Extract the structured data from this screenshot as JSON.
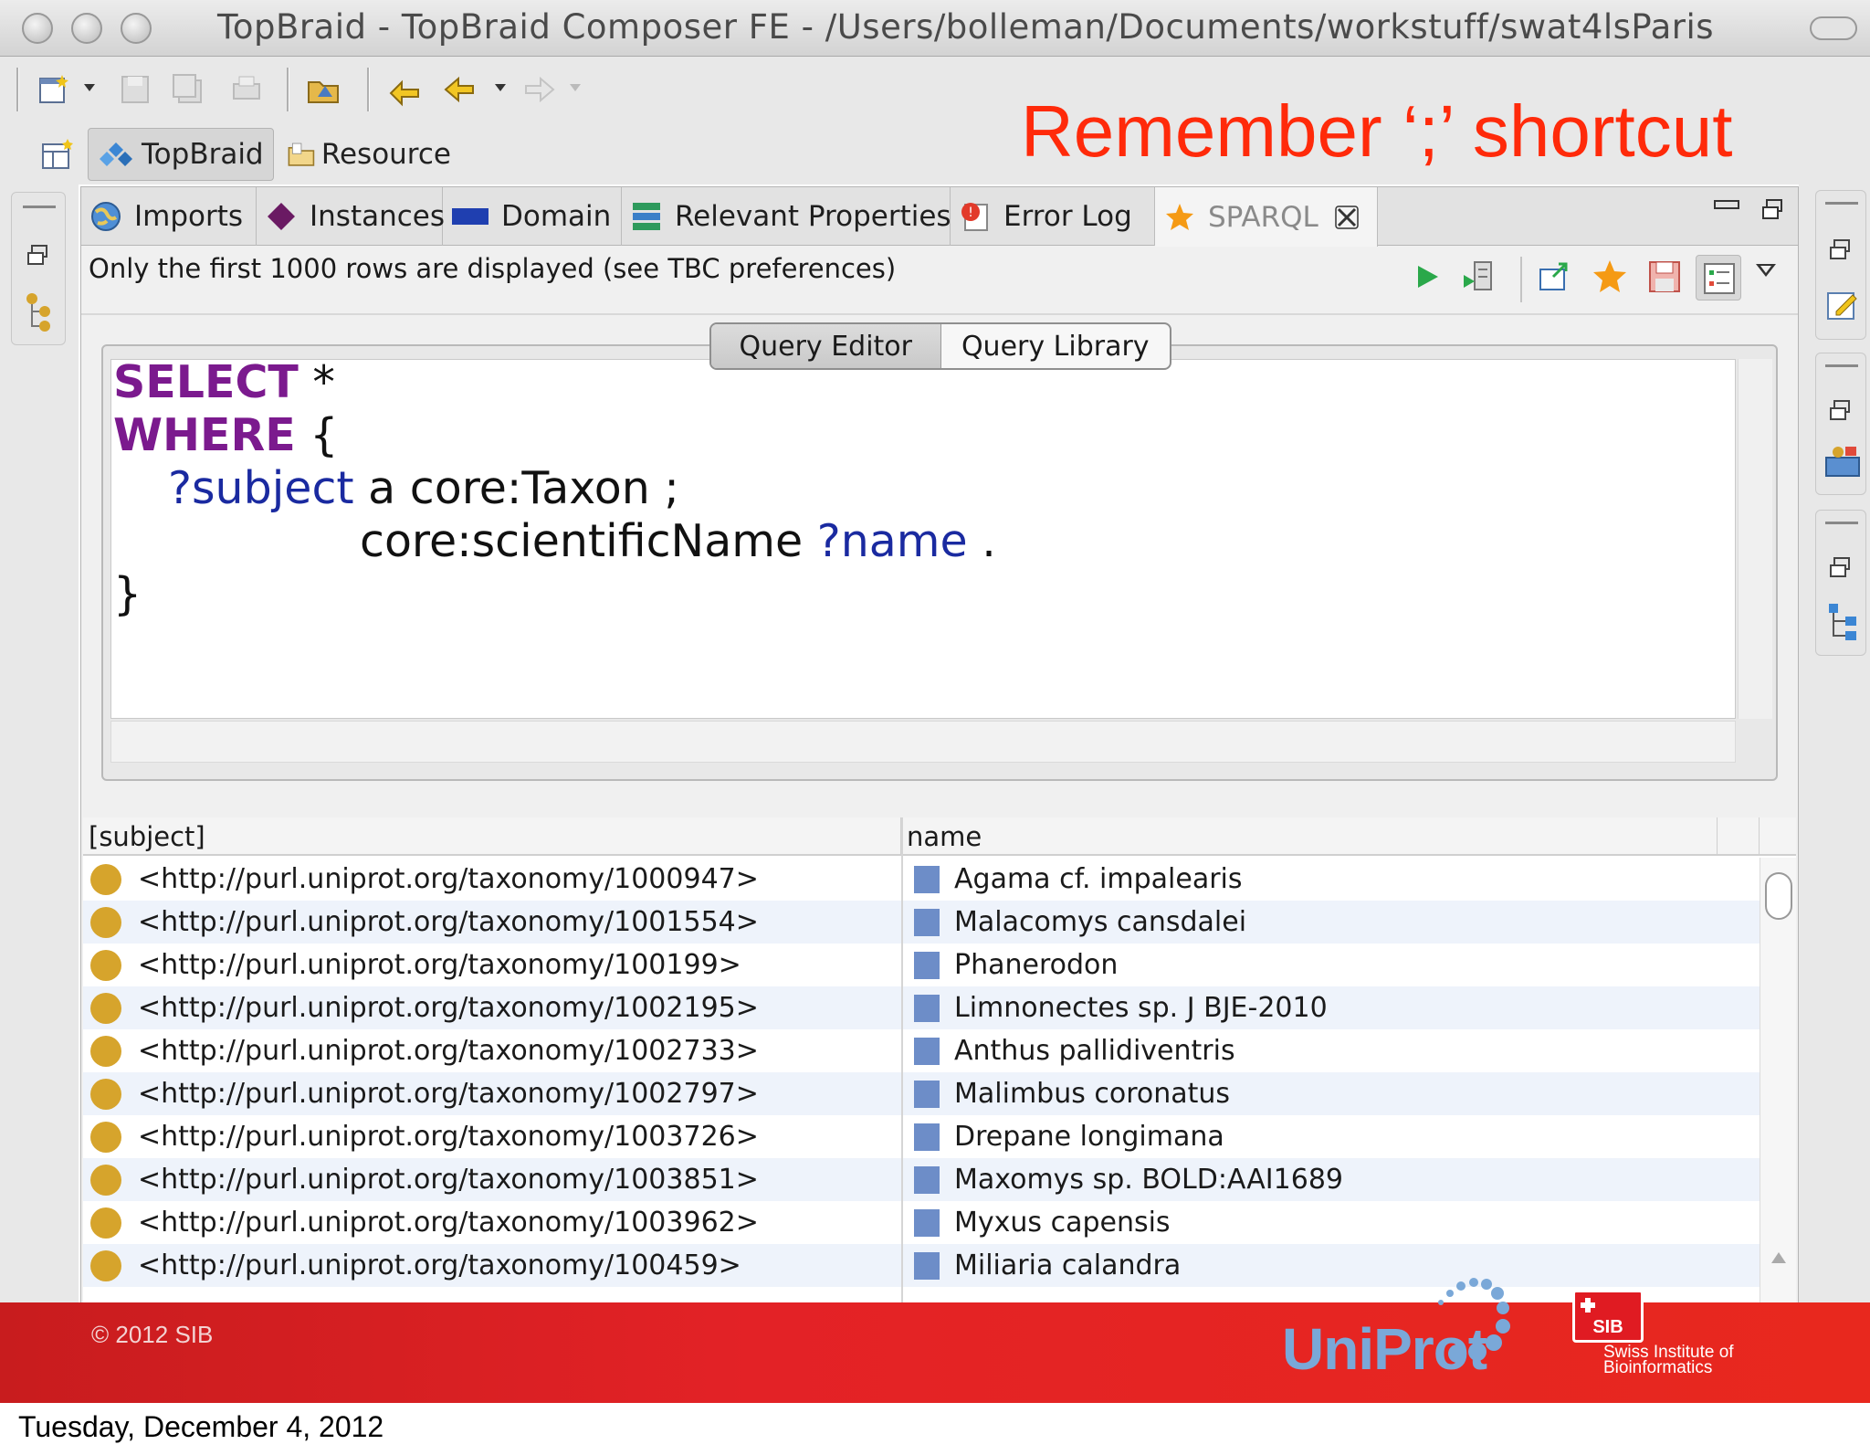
{
  "window": {
    "title": "TopBraid - TopBraid Composer FE - /Users/bolleman/Documents/workstuff/swat4lsParis"
  },
  "perspectives": [
    {
      "label": "TopBraid",
      "active": true
    },
    {
      "label": "Resource",
      "active": false
    }
  ],
  "annotation": "Remember ‘;’ shortcut",
  "tabs": [
    {
      "label": "Imports",
      "icon": "globe-icon"
    },
    {
      "label": "Instances",
      "icon": "diamond-icon"
    },
    {
      "label": "Domain",
      "icon": "blue-bar-icon"
    },
    {
      "label": "Relevant Properties",
      "icon": "properties-icon"
    },
    {
      "label": "Error Log",
      "icon": "error-log-icon"
    },
    {
      "label": "SPARQL",
      "icon": "star-icon",
      "active": true
    }
  ],
  "info_text": "Only the first 1000 rows are displayed (see TBC preferences)",
  "editor_tabs": {
    "query_editor": "Query Editor",
    "query_library": "Query Library"
  },
  "query": {
    "line1_kw": "SELECT",
    "line1_rest": " *",
    "line2_kw": "WHERE",
    "line2_rest": " {",
    "line3_var": "?subject",
    "line3_rest": " a core:Taxon ;",
    "line4_pre": "core:scientificName ",
    "line4_var": "?name",
    "line4_rest": " .",
    "line5": "}"
  },
  "results": {
    "columns": [
      "[subject]",
      "name"
    ],
    "rows": [
      {
        "subject": "<http://purl.uniprot.org/taxonomy/1000947>",
        "name": "Agama cf. impalearis"
      },
      {
        "subject": "<http://purl.uniprot.org/taxonomy/1001554>",
        "name": "Malacomys cansdalei"
      },
      {
        "subject": "<http://purl.uniprot.org/taxonomy/100199>",
        "name": "Phanerodon"
      },
      {
        "subject": "<http://purl.uniprot.org/taxonomy/1002195>",
        "name": "Limnonectes sp. J BJE-2010"
      },
      {
        "subject": "<http://purl.uniprot.org/taxonomy/1002733>",
        "name": "Anthus pallidiventris"
      },
      {
        "subject": "<http://purl.uniprot.org/taxonomy/1002797>",
        "name": "Malimbus coronatus"
      },
      {
        "subject": "<http://purl.uniprot.org/taxonomy/1003726>",
        "name": "Drepane longimana"
      },
      {
        "subject": "<http://purl.uniprot.org/taxonomy/1003851>",
        "name": "Maxomys sp. BOLD:AAI1689"
      },
      {
        "subject": "<http://purl.uniprot.org/taxonomy/1003962>",
        "name": "Myxus capensis"
      },
      {
        "subject": "<http://purl.uniprot.org/taxonomy/100459>",
        "name": "Miliaria calandra"
      }
    ]
  },
  "footer": {
    "copyright": "© 2012 SIB",
    "uniprot_logo": "UniProt",
    "sib_logo": "SIB",
    "sib_name": "Swiss Institute of Bioinformatics"
  },
  "date": "Tuesday, December 4, 2012",
  "colors": {
    "annotation": "#ff2a0a",
    "keyword": "#7b1a8e",
    "variable": "#1a2aa0",
    "footer": "#e32226"
  }
}
